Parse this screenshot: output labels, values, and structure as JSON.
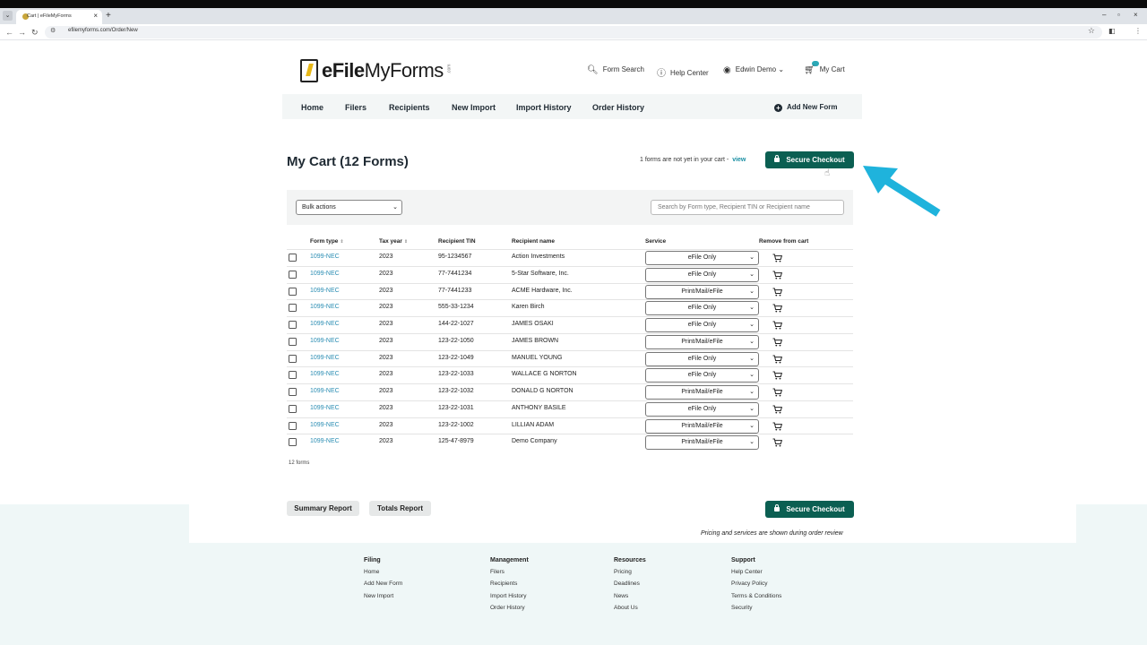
{
  "browser": {
    "tab_title": "Cart | eFileMyForms",
    "url": "efilemyforms.com/Order/New"
  },
  "header": {
    "logo_main": "eFile",
    "logo_rest": "MyForms",
    "logo_suffix": ".com",
    "form_search": "Form Search",
    "help_center": "Help Center",
    "user_name": "Edwin Demo",
    "cart_label": "My Cart"
  },
  "nav": {
    "items": [
      "Home",
      "Filers",
      "Recipients",
      "New Import",
      "Import History",
      "Order History"
    ],
    "add_new_form": "Add New Form"
  },
  "page": {
    "title": "My Cart (12 Forms)",
    "not_in_cart_text": "1 forms are not yet in your cart -",
    "view_link": "view",
    "secure_checkout": "Secure Checkout"
  },
  "toolbar": {
    "bulk_actions": "Bulk actions",
    "search_placeholder": "Search by Form type, Recipient TIN or Recipient name"
  },
  "table": {
    "headers": {
      "form_type": "Form type",
      "tax_year": "Tax year",
      "recipient_tin": "Recipient TIN",
      "recipient_name": "Recipient name",
      "service": "Service",
      "remove": "Remove from cart"
    },
    "rows": [
      {
        "form": "1099-NEC",
        "year": "2023",
        "tin": "95-1234567",
        "name": "Action Investments",
        "service": "eFile Only"
      },
      {
        "form": "1099-NEC",
        "year": "2023",
        "tin": "77-7441234",
        "name": "5-Star Software, Inc.",
        "service": "eFile Only"
      },
      {
        "form": "1099-NEC",
        "year": "2023",
        "tin": "77-7441233",
        "name": "ACME Hardware, Inc.",
        "service": "Print/Mail/eFile"
      },
      {
        "form": "1099-NEC",
        "year": "2023",
        "tin": "555-33-1234",
        "name": "Karen Birch",
        "service": "eFile Only"
      },
      {
        "form": "1099-NEC",
        "year": "2023",
        "tin": "144-22-1027",
        "name": "JAMES OSAKI",
        "service": "eFile Only"
      },
      {
        "form": "1099-NEC",
        "year": "2023",
        "tin": "123-22-1050",
        "name": "JAMES BROWN",
        "service": "Print/Mail/eFile"
      },
      {
        "form": "1099-NEC",
        "year": "2023",
        "tin": "123-22-1049",
        "name": "MANUEL YOUNG",
        "service": "eFile Only"
      },
      {
        "form": "1099-NEC",
        "year": "2023",
        "tin": "123-22-1033",
        "name": "WALLACE G NORTON",
        "service": "eFile Only"
      },
      {
        "form": "1099-NEC",
        "year": "2023",
        "tin": "123-22-1032",
        "name": "DONALD G NORTON",
        "service": "Print/Mail/eFile"
      },
      {
        "form": "1099-NEC",
        "year": "2023",
        "tin": "123-22-1031",
        "name": "ANTHONY BASILE",
        "service": "eFile Only"
      },
      {
        "form": "1099-NEC",
        "year": "2023",
        "tin": "123-22-1002",
        "name": "LILLIAN ADAM",
        "service": "Print/Mail/eFile"
      },
      {
        "form": "1099-NEC",
        "year": "2023",
        "tin": "125-47-8979",
        "name": "Demo Company",
        "service": "Print/Mail/eFile"
      }
    ],
    "count_text": "12 forms"
  },
  "actions": {
    "summary_report": "Summary Report",
    "totals_report": "Totals Report",
    "secure_checkout": "Secure Checkout",
    "pricing_note": "Pricing and services are shown during order review"
  },
  "footer": {
    "columns": [
      {
        "heading": "Filing",
        "links": [
          "Home",
          "Add New Form",
          "New Import"
        ]
      },
      {
        "heading": "Management",
        "links": [
          "Filers",
          "Recipients",
          "Import History",
          "Order History"
        ]
      },
      {
        "heading": "Resources",
        "links": [
          "Pricing",
          "Deadlines",
          "News",
          "About Us"
        ]
      },
      {
        "heading": "Support",
        "links": [
          "Help Center",
          "Privacy Policy",
          "Terms & Conditions",
          "Security"
        ]
      }
    ]
  },
  "colors": {
    "brand_green": "#0b5f52",
    "link_blue": "#2a8db3",
    "annotation_arrow": "#1fb3dc"
  }
}
